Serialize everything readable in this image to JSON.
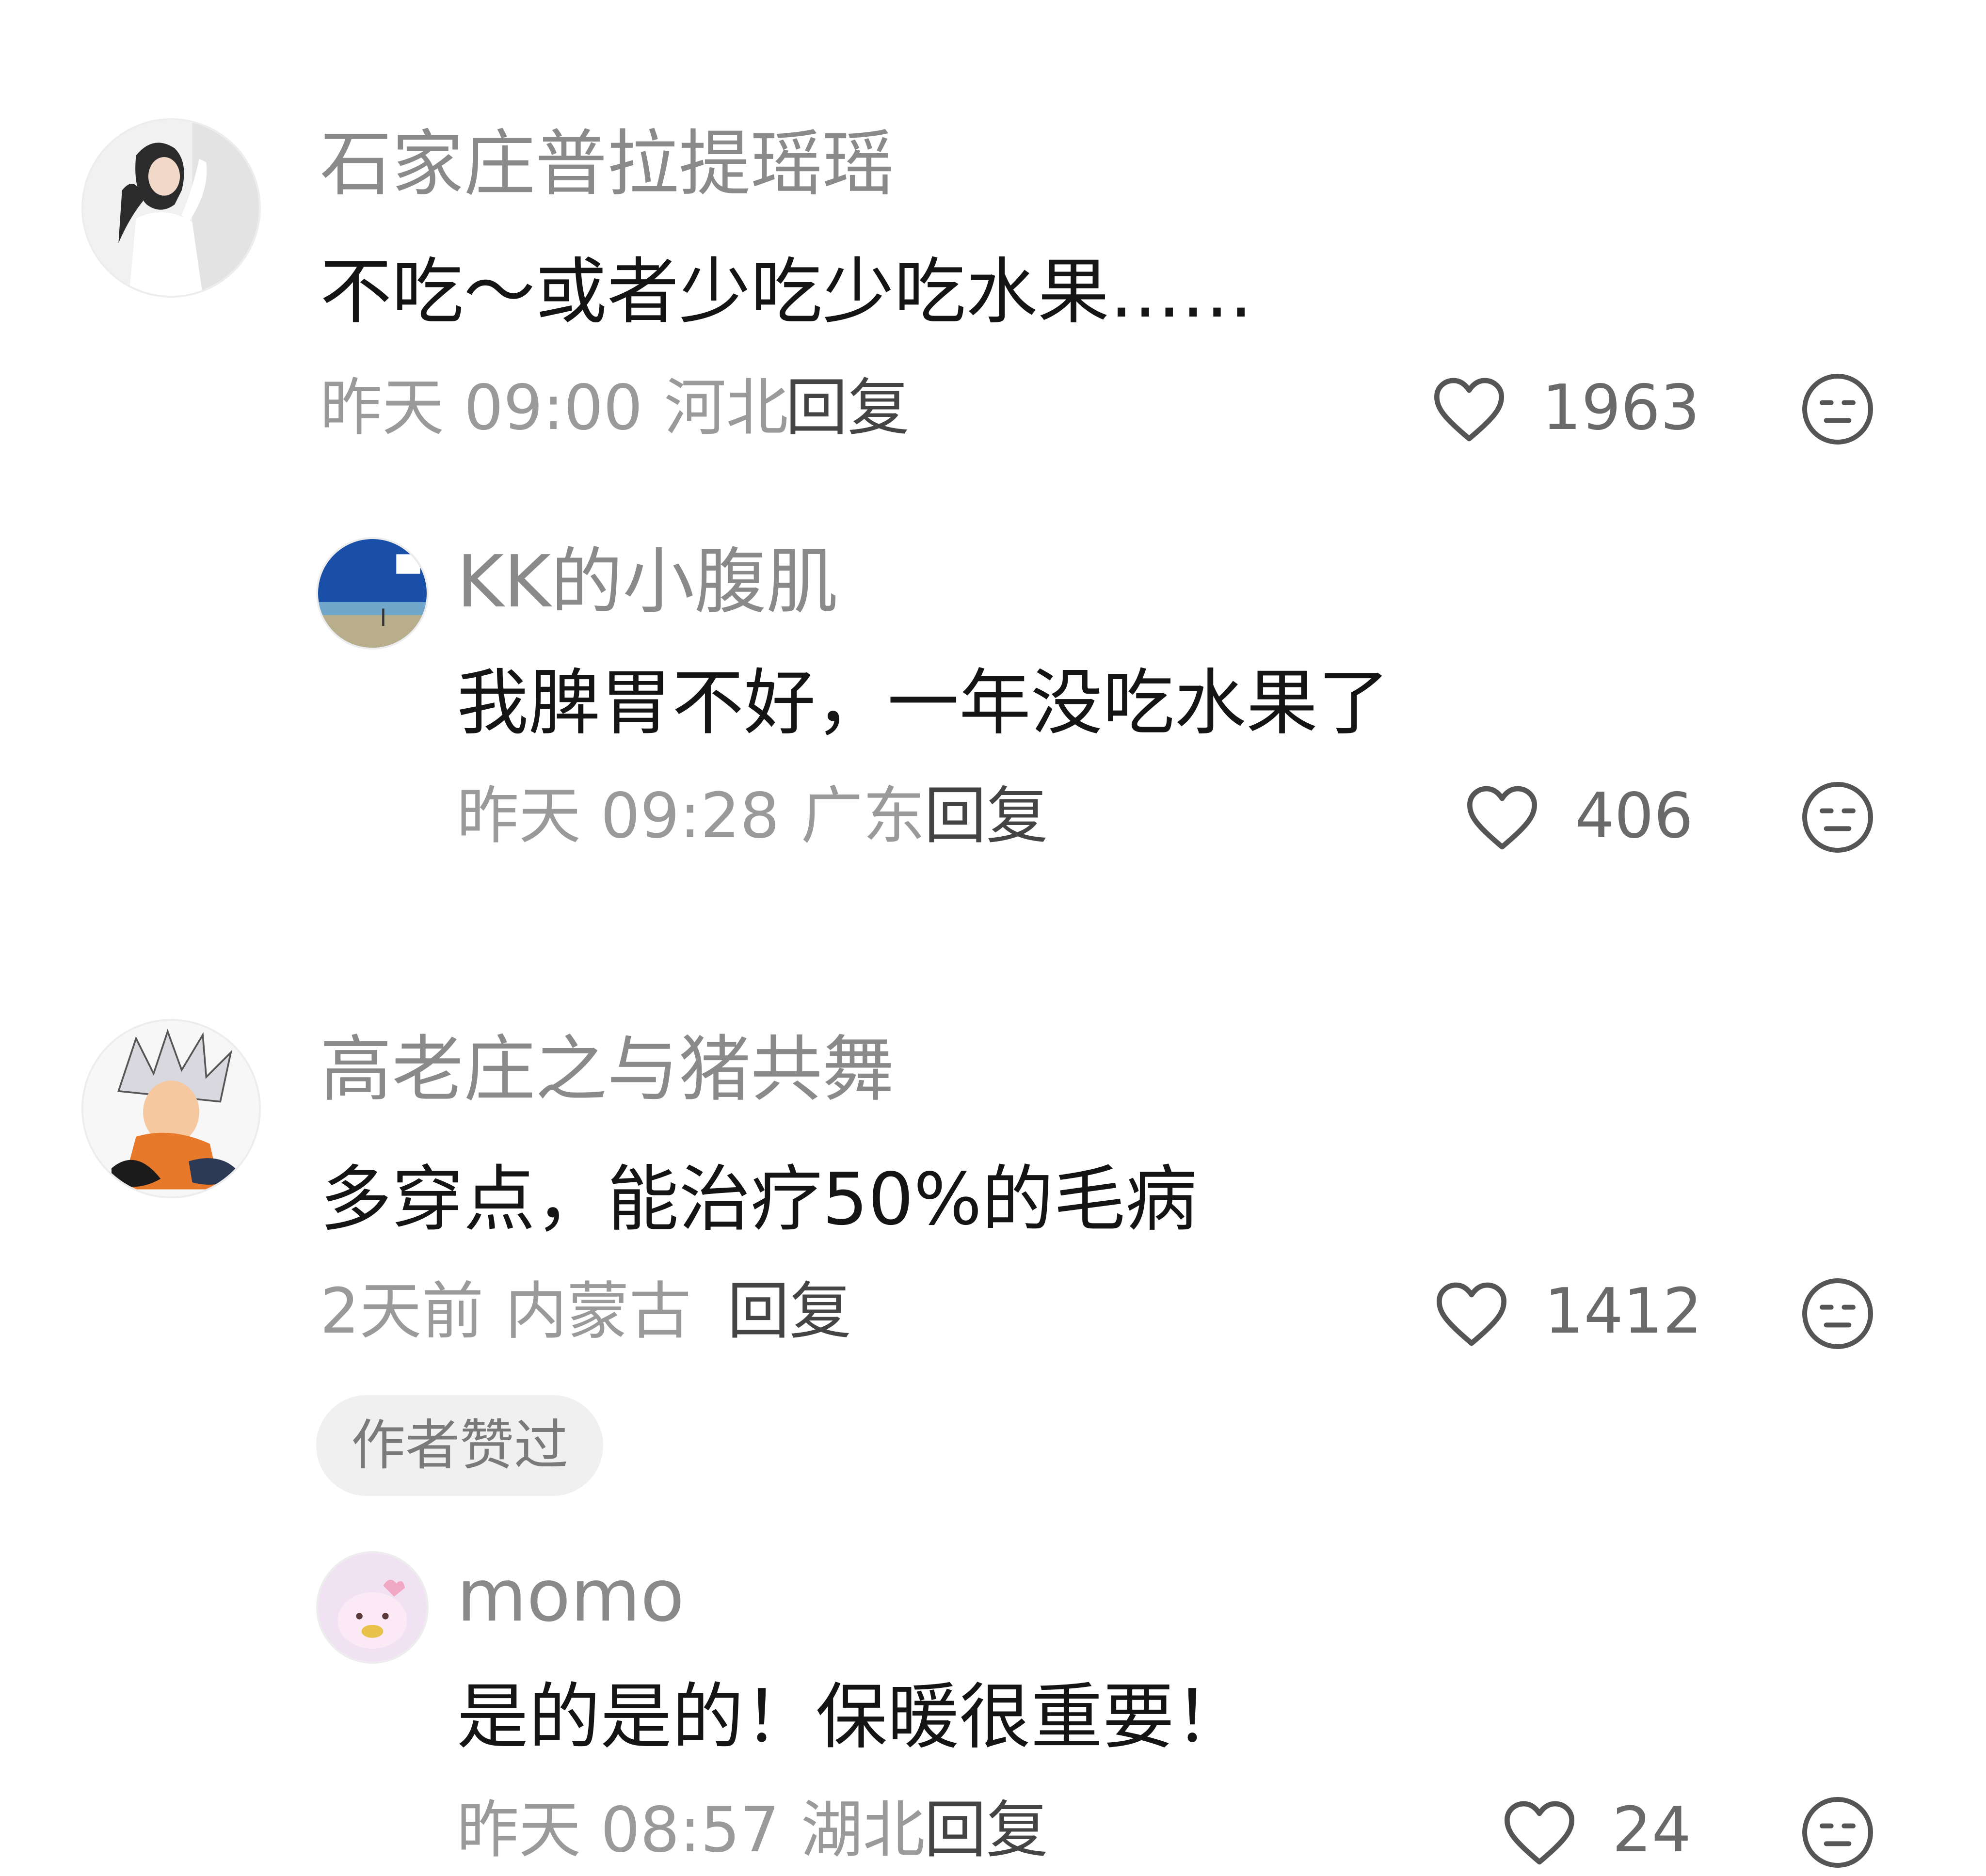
{
  "comments": [
    {
      "username": "石家庄普拉提瑶瑶",
      "content": "不吃～或者少吃少吃水果……",
      "time": "昨天 09:00",
      "location": "河北",
      "reply_label": "回复",
      "likes": "1963",
      "avatar_icon": "woman-portrait-avatar"
    },
    {
      "username": "KK的小腹肌",
      "content": "我脾胃不好，一年没吃水果了",
      "time": "昨天 09:28",
      "location": "广东",
      "reply_label": "回复",
      "likes": "406",
      "avatar_icon": "beach-sky-avatar"
    },
    {
      "username": "高老庄之与猪共舞",
      "content": "多穿点，能治疗50%的毛病",
      "time": "2天前",
      "location": "内蒙古",
      "reply_label": "回复",
      "likes": "1412",
      "badge": "作者赞过",
      "avatar_icon": "anime-character-avatar"
    },
    {
      "username": "momo",
      "content": "是的是的！保暖很重要！",
      "time": "昨天 08:57",
      "location": "湖北",
      "reply_label": "回复",
      "likes": "24",
      "avatar_icon": "pink-cartoon-avatar"
    }
  ],
  "colors": {
    "username": "#8a8a8a",
    "content": "#141414",
    "meta": "#9a9a9a",
    "icon": "#555555",
    "badge_bg": "#f0f0f0"
  }
}
